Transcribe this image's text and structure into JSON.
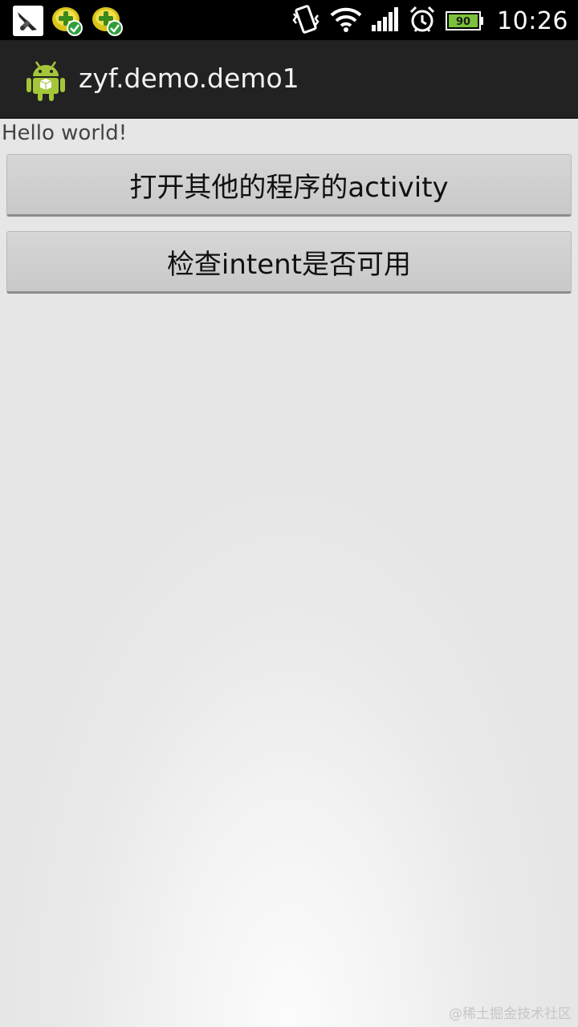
{
  "status_bar": {
    "battery_level": "90",
    "time": "10:26",
    "icons": [
      "app-notification-icon",
      "game-notification-icon",
      "game-notification-icon",
      "vibrate-icon",
      "wifi-icon",
      "signal-icon",
      "alarm-icon",
      "battery-icon"
    ]
  },
  "action_bar": {
    "title": "zyf.demo.demo1",
    "icon": "android-robot-icon"
  },
  "content": {
    "hello_text": "Hello world!",
    "button_open_activity": "打开其他的程序的activity",
    "button_check_intent": "检查intent是否可用"
  },
  "watermark": "@稀土掘金技术社区",
  "colors": {
    "status_bar_bg": "#000000",
    "action_bar_bg": "#222222",
    "battery_green": "#7bc23a",
    "android_green": "#a4c639",
    "button_bg": "#cfcfcf"
  }
}
